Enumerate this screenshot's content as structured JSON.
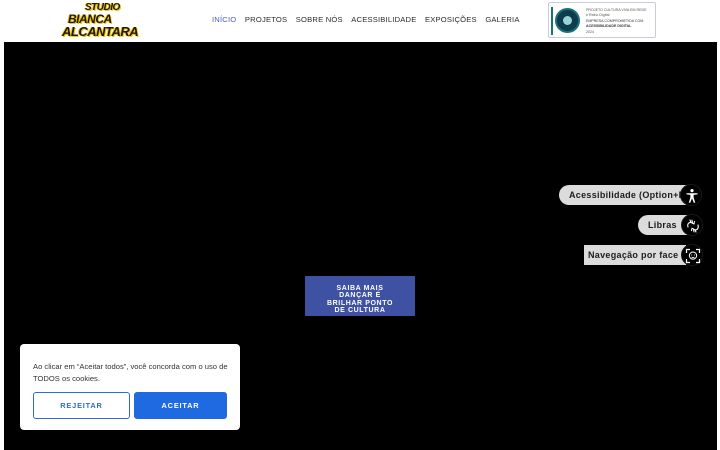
{
  "header": {
    "logo": {
      "line1": "STUDIO",
      "line2": "BIANCA",
      "line3": "ALCANTARA"
    },
    "nav": [
      {
        "label": "INÍCIO",
        "active": true
      },
      {
        "label": "PROJETOS",
        "active": false
      },
      {
        "label": "SOBRE NÓS",
        "active": false
      },
      {
        "label": "ACESSIBILIDADE",
        "active": false
      },
      {
        "label": "EXPOSIÇÕES",
        "active": false
      },
      {
        "label": "GALERIA",
        "active": false
      }
    ],
    "badge": {
      "line1": "PROJETO CULTURA VIVA EM REDE",
      "line2": "e Reino Digital",
      "line3": "EMPRESA COMPROMETIDA COM",
      "line4": "ACESSIBILIDADE DIGITAL",
      "line5": "2024"
    }
  },
  "hero": {
    "cta_lines": [
      "SAIBA MAIS",
      "DANÇAR É",
      "BRILHAR PONTO",
      "DE CULTURA"
    ]
  },
  "accessibility": {
    "main_label": "Acessibilidade (Option+P)",
    "libras_label": "Libras",
    "face_label": "Navegação por face"
  },
  "cookie": {
    "message": "Ao clicar em “Aceitar todos”, você concorda com o uso de TODOS os cookies.",
    "reject_label": "REJEITAR",
    "accept_label": "ACEITAR"
  },
  "colors": {
    "accent": "#4d5bc0",
    "cta_bg": "#3f51a3",
    "accept_bg": "#1f6ae0",
    "hero_bg": "#000000",
    "logo_yellow": "#f5c400"
  }
}
